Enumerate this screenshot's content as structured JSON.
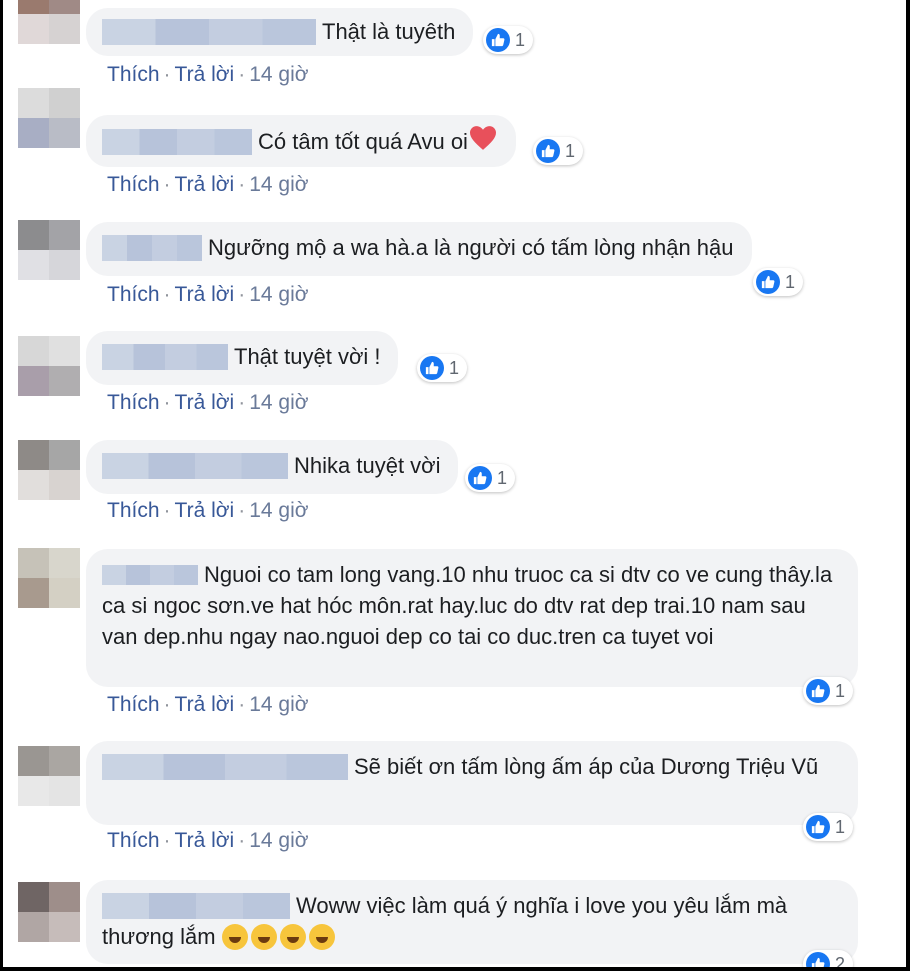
{
  "action_labels": {
    "like": "Thích",
    "reply": "Trả lời",
    "separator": "·"
  },
  "comments": [
    {
      "text": "Thật là tuyêth",
      "time": "14 giờ",
      "likes": "1"
    },
    {
      "text": "Có tâm tốt quá Avu oi",
      "time": "14 giờ",
      "likes": "1"
    },
    {
      "text": "Ngưỡng mộ a wa hà.a là người có tấm lòng nhận hậu",
      "time": "14 giờ",
      "likes": "1"
    },
    {
      "text": "Thật tuyệt vời !",
      "time": "14 giờ",
      "likes": "1"
    },
    {
      "text": "Nhika tuyệt vời",
      "time": "14 giờ",
      "likes": "1"
    },
    {
      "text": "Nguoi co tam long vang.10 nhu truoc ca si dtv co ve cung thây.la ca si ngoc sơn.ve hat hóc môn.rat hay.luc do dtv rat dep trai.10 nam sau van dep.nhu ngay nao.nguoi dep co tai co duc.tren ca tuyet voi",
      "time": "14 giờ",
      "likes": "1"
    },
    {
      "text": "Sẽ biết ơn tấm lòng ấm áp của Dương Triệu Vũ",
      "time": "14 giờ",
      "likes": "1"
    },
    {
      "text": "Woww việc làm quá ý nghĩa i love you yêu lắm mà thương lắm",
      "likes": "2"
    }
  ],
  "colors": {
    "bubble": "#f2f3f5",
    "link": "#385898",
    "like_blue": "#1877f2"
  },
  "icons": {
    "reaction": "like-icon",
    "heart": "heart-icon",
    "emoji": "rofl-emoji-icon"
  }
}
